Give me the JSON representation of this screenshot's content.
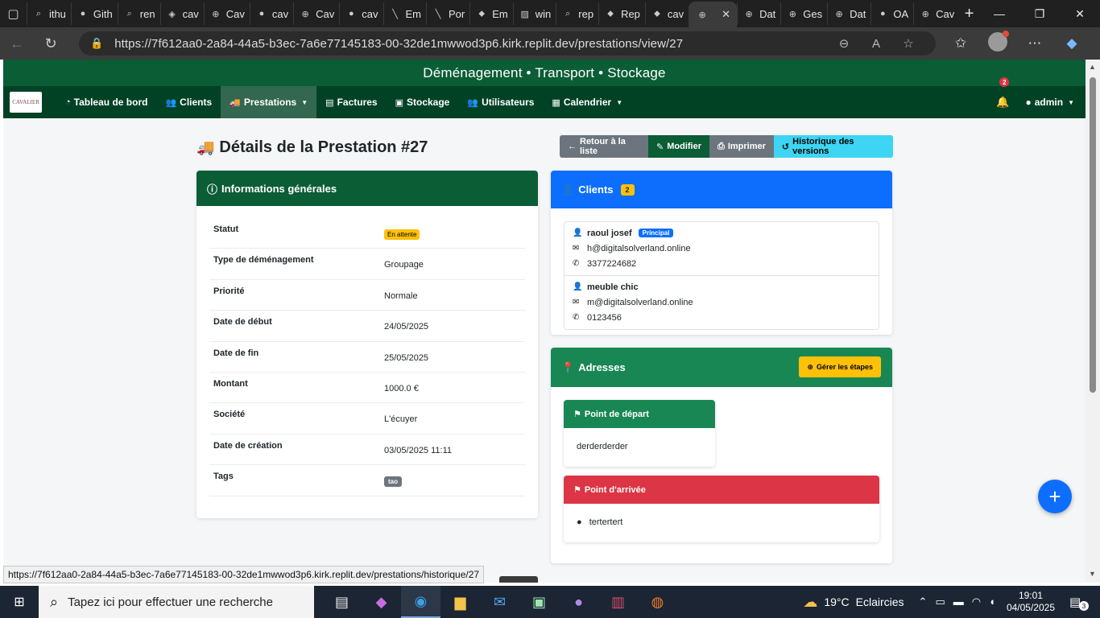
{
  "browser": {
    "tabs": [
      {
        "label": "ithu",
        "icon": "search-icon"
      },
      {
        "label": "Gith",
        "icon": "github-icon"
      },
      {
        "label": "ren",
        "icon": "search-icon"
      },
      {
        "label": "cav",
        "icon": "app-icon"
      },
      {
        "label": "Cav",
        "icon": "globe-icon"
      },
      {
        "label": "cav",
        "icon": "github-icon"
      },
      {
        "label": "Cav",
        "icon": "globe-icon"
      },
      {
        "label": "cav",
        "icon": "github-icon"
      },
      {
        "label": "Em",
        "icon": "slash-icon"
      },
      {
        "label": "Por",
        "icon": "slash-icon"
      },
      {
        "label": "Em",
        "icon": "replit-icon"
      },
      {
        "label": "win",
        "icon": "image-icon"
      },
      {
        "label": "rep",
        "icon": "search-icon"
      },
      {
        "label": "Rep",
        "icon": "replit-icon"
      },
      {
        "label": "cav",
        "icon": "replit-icon"
      },
      {
        "label": "",
        "icon": "globe-icon",
        "active": true
      },
      {
        "label": "Dat",
        "icon": "globe-icon"
      },
      {
        "label": "Ges",
        "icon": "globe-icon"
      },
      {
        "label": "Dat",
        "icon": "globe-icon"
      },
      {
        "label": "OA",
        "icon": "github-icon"
      },
      {
        "label": "Cav",
        "icon": "globe-icon"
      }
    ],
    "url": "https://7f612aa0-2a84-44a5-b3ec-7a6e77145183-00-32de1mwwod3p6.kirk.replit.dev/prestations/view/27",
    "status_url": "https://7f612aa0-2a84-44a5-b3ec-7a6e77145183-00-32de1mwwod3p6.kirk.replit.dev/prestations/historique/27"
  },
  "app": {
    "brand_banner": "Déménagement • Transport • Stockage",
    "logo_text": "CAVALIER",
    "nav": [
      {
        "label": "Tableau de bord",
        "icon": "dashboard-icon"
      },
      {
        "label": "Clients",
        "icon": "users-icon"
      },
      {
        "label": "Prestations",
        "icon": "truck-icon",
        "active": true,
        "dropdown": true
      },
      {
        "label": "Factures",
        "icon": "file-icon"
      },
      {
        "label": "Stockage",
        "icon": "box-icon"
      },
      {
        "label": "Utilisateurs",
        "icon": "users-icon"
      },
      {
        "label": "Calendrier",
        "icon": "calendar-icon",
        "dropdown": true
      }
    ],
    "notifications_count": "2",
    "user": "admin"
  },
  "page": {
    "title": "Détails de la Prestation #27",
    "buttons": {
      "back": "Retour à la liste",
      "edit": "Modifier",
      "print": "Imprimer",
      "history": "Historique des versions"
    },
    "info": {
      "header": "Informations générales",
      "rows": [
        {
          "label": "Statut",
          "value": "En attente",
          "kind": "badge-warning"
        },
        {
          "label": "Type de déménagement",
          "value": "Groupage"
        },
        {
          "label": "Priorité",
          "value": "Normale"
        },
        {
          "label": "Date de début",
          "value": "24/05/2025"
        },
        {
          "label": "Date de fin",
          "value": "25/05/2025"
        },
        {
          "label": "Montant",
          "value": "1000.0 €"
        },
        {
          "label": "Société",
          "value": "L'écuyer"
        },
        {
          "label": "Date de création",
          "value": "03/05/2025 11:11"
        },
        {
          "label": "Tags",
          "value": "tao",
          "kind": "badge-tag"
        }
      ]
    },
    "clients": {
      "header": "Clients",
      "count": "2",
      "list": [
        {
          "name": "raoul josef",
          "badge": "Principal",
          "email": "h@digitalsolverland.online",
          "phone": "3377224682"
        },
        {
          "name": "meuble chic",
          "email": "m@digitalsolverland.online",
          "phone": "0123456"
        }
      ]
    },
    "addresses": {
      "header": "Adresses",
      "manage_button": "Gérer les étapes",
      "departure": {
        "title": "Point de départ",
        "value": "derderderder"
      },
      "arrival": {
        "title": "Point d'arrivée",
        "value": "tertertert"
      }
    }
  },
  "taskbar": {
    "search_placeholder": "Tapez ici pour effectuer une recherche",
    "weather": {
      "temp": "19°C",
      "desc": "Eclaircies"
    },
    "time": "19:01",
    "date": "04/05/2025",
    "notifications": "3"
  },
  "colors": {
    "brand_green": "#0b5d36",
    "nav_green": "#014225",
    "primary": "#0d6efd",
    "success": "#198754",
    "danger": "#dc3545",
    "warning": "#ffc107",
    "info": "#3dd5f3"
  }
}
